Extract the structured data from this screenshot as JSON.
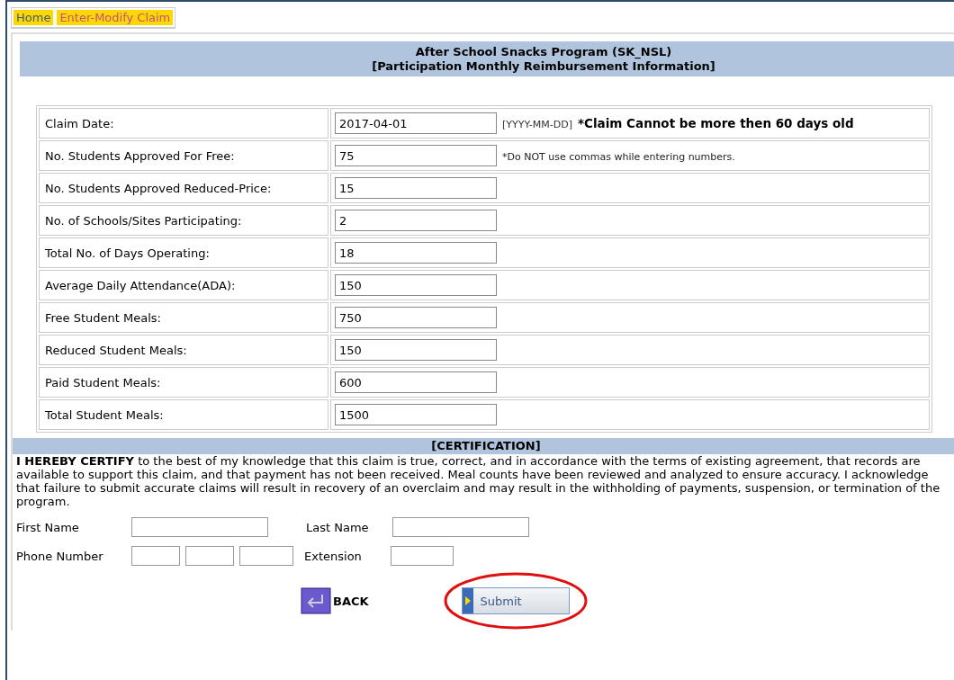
{
  "tabs": [
    {
      "label": "Home",
      "selected": false
    },
    {
      "label": "Enter-Modify Claim",
      "selected": true
    }
  ],
  "header": {
    "title": "After School Snacks Program (SK_NSL)",
    "subtitle": "[Participation Monthly Reimbursement Information]"
  },
  "fields": [
    {
      "label": "Claim Date:",
      "value": "2017-04-01",
      "hint": "[YYYY-MM-DD]",
      "warning": "*Claim Cannot be more then 60 days old"
    },
    {
      "label": "No. Students Approved For Free:",
      "value": "75",
      "hint": "*Do NOT use commas while entering numbers."
    },
    {
      "label": "No. Students Approved Reduced-Price:",
      "value": "15"
    },
    {
      "label": "No. of Schools/Sites Participating:",
      "value": "2"
    },
    {
      "label": "Total No. of Days Operating:",
      "value": "18"
    },
    {
      "label": "Average Daily Attendance(ADA):",
      "value": "150"
    },
    {
      "label": "Free Student Meals:",
      "value": "750"
    },
    {
      "label": "Reduced Student Meals:",
      "value": "150"
    },
    {
      "label": "Paid Student Meals:",
      "value": "600"
    },
    {
      "label": "Total Student Meals:",
      "value": "1500"
    }
  ],
  "certification": {
    "title": "[CERTIFICATION]",
    "text": "**I HEREBY CERTIFY** to the best of my knowledge that this claim is true, correct, and in accordance with the terms of existing agreement, that records are available to support this claim, and that payment has not been received. Meal counts have been reviewed and analyzed to ensure accuracy. I acknowledge that failure to submit accurate claims will result in recovery of an overclaim and may result in the withholding of payments, suspension, or termination of the program."
  },
  "contact": {
    "first_name": "First Name",
    "last_name": "Last Name",
    "phone": "Phone Number",
    "extension": "Extension"
  },
  "buttons": {
    "back": "BACK",
    "submit": "Submit"
  }
}
